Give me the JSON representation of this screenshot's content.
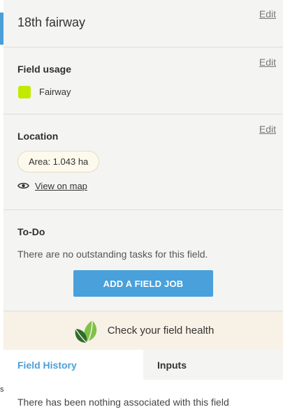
{
  "field": {
    "name": "18th fairway",
    "edit_label": "Edit"
  },
  "usage": {
    "title": "Field usage",
    "edit_label": "Edit",
    "value": "Fairway",
    "swatch_color": "#c2ea00"
  },
  "location": {
    "title": "Location",
    "edit_label": "Edit",
    "area": "Area: 1.043 ha",
    "view_map": "View on map"
  },
  "todo": {
    "title": "To-Do",
    "empty_message": "There are no outstanding tasks for this field.",
    "add_button": "ADD A FIELD JOB"
  },
  "health": {
    "label": "Check your field health"
  },
  "tabs": [
    {
      "label": "Field History",
      "active": true
    },
    {
      "label": "Inputs",
      "active": false
    }
  ],
  "history": {
    "empty_message": "There has been nothing associated with this field"
  },
  "colors": {
    "accent": "#4a9fd8",
    "button": "#4aa0da"
  }
}
